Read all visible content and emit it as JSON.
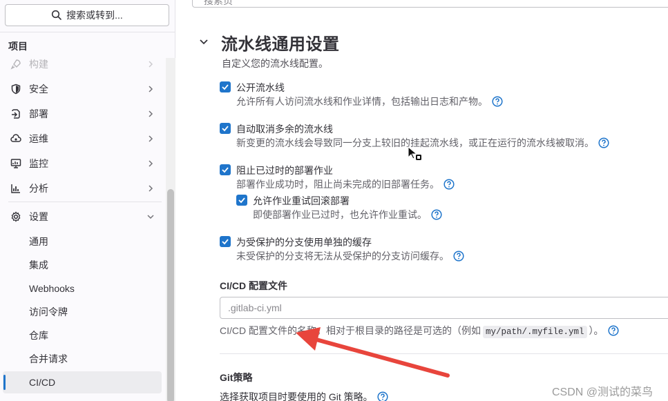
{
  "sidebar": {
    "search_label": "搜索或转到...",
    "section_label": "项目",
    "items": [
      {
        "label": "构建",
        "icon": "rocket-icon"
      },
      {
        "label": "安全",
        "icon": "shield-icon"
      },
      {
        "label": "部署",
        "icon": "deployments-icon"
      },
      {
        "label": "运维",
        "icon": "cloud-gear-icon"
      },
      {
        "label": "监控",
        "icon": "monitor-icon"
      },
      {
        "label": "分析",
        "icon": "chart-icon"
      },
      {
        "label": "设置",
        "icon": "gear-icon"
      }
    ],
    "settings_subitems": [
      "通用",
      "集成",
      "Webhooks",
      "访问令牌",
      "仓库",
      "合并请求",
      "CI/CD"
    ],
    "active_item": "CI/CD"
  },
  "main": {
    "top_search_placeholder": "搜索页",
    "section_title": "流水线通用设置",
    "section_desc": "自定义您的流水线配置。",
    "checkboxes": [
      {
        "label": "公开流水线",
        "help": "允许所有人访问流水线和作业详情，包括输出日志和产物。",
        "checked": true
      },
      {
        "label": "自动取消多余的流水线",
        "help": "新变更的流水线会导致同一分支上较旧的挂起流水线，或正在运行的流水线被取消。",
        "checked": true
      },
      {
        "label": "阻止已过时的部署作业",
        "help": "部署作业成功时，阻止尚未完成的旧部署任务。",
        "checked": true
      },
      {
        "label": "允许作业重试回滚部署",
        "help": "即使部署作业已过时，也允许作业重试。",
        "checked": true
      },
      {
        "label": "为受保护的分支使用单独的缓存",
        "help": "未受保护的分支将无法从受保护的分支访问缓存。",
        "checked": true
      }
    ],
    "ci_config": {
      "label": "CI/CD 配置文件",
      "placeholder": ".gitlab-ci.yml",
      "help_before": "CI/CD 配置文件的名称。相对于根目录的路径是可选的（例如",
      "help_code": "my/path/.myfile.yml",
      "help_after": "）。"
    },
    "git_strategy": {
      "label": "Git策略",
      "help": "选择获取项目时要使用的 Git 策略。"
    }
  },
  "watermark": "CSDN @测试的菜鸟",
  "colors": {
    "accent": "#1f75cb",
    "arrow": "#e8453c"
  }
}
